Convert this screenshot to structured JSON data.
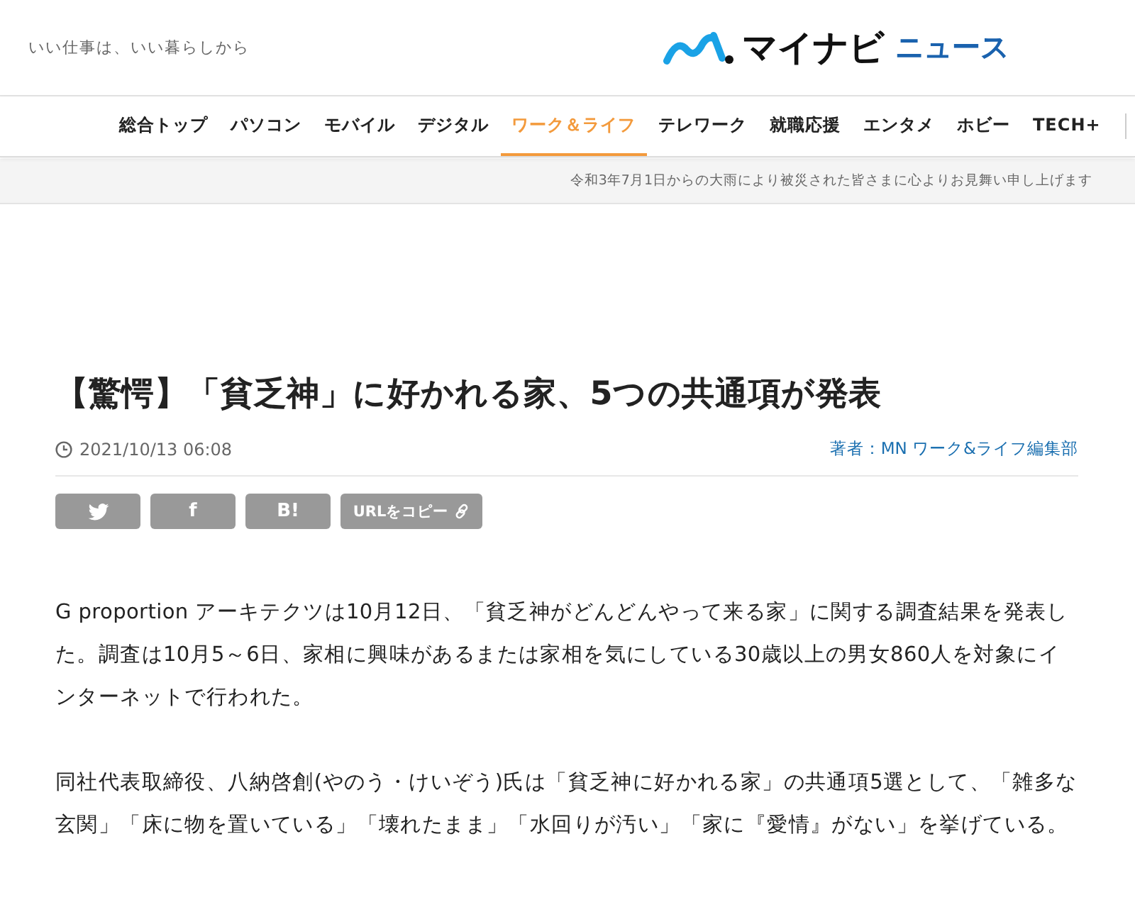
{
  "header": {
    "tagline": "いい仕事は、いい暮らしから",
    "logo": {
      "brand": "マイナビ",
      "service": "ニュース"
    }
  },
  "nav": [
    {
      "label": "総合トップ",
      "selected": false
    },
    {
      "label": "パソコン",
      "selected": false
    },
    {
      "label": "モバイル",
      "selected": false
    },
    {
      "label": "デジタル",
      "selected": false
    },
    {
      "label": "ワーク＆ライフ",
      "selected": true
    },
    {
      "label": "テレワーク",
      "selected": false
    },
    {
      "label": "就職応援",
      "selected": false
    },
    {
      "label": "エンタメ",
      "selected": false
    },
    {
      "label": "ホビー",
      "selected": false
    },
    {
      "label": "TECH+",
      "selected": false
    }
  ],
  "notice": "令和3年7月1日からの大雨により被災された皆さまに心よりお見舞い申し上げます",
  "article": {
    "title": "【驚愕】「貧乏神」に好かれる家、5つの共通項が発表",
    "date": "2021/10/13 06:08",
    "author": "著者：MN ワーク&ライフ編集部",
    "share": [
      {
        "kind": "twitter"
      },
      {
        "kind": "text",
        "label": "f"
      },
      {
        "kind": "text",
        "label": "B!"
      },
      {
        "kind": "copy",
        "label": "URLをコピー"
      }
    ],
    "paragraphs": [
      "G proportion アーキテクツは10月12日、「貧乏神がどんどんやって来る家」に関する調査結果を発表した。調査は10月5～6日、家相に興味があるまたは家相を気にしている30歳以上の男女860人を対象にインターネットで行われた。",
      "同社代表取締役、八納啓創(やのう・けいぞう)氏は「貧乏神に好かれる家」の共通項5選として、「雑多な玄関」「床に物を置いている」「壊れたまま」「水回りが汚い」「家に『愛情』がない」を挙げている。"
    ]
  }
}
